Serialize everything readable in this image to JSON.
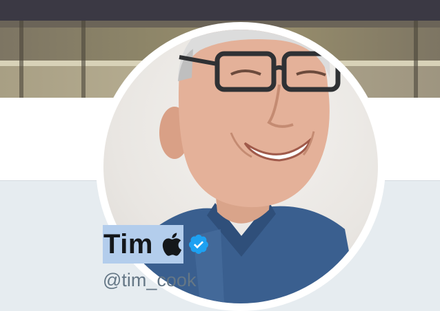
{
  "profile": {
    "display_name": "Tim",
    "emoji": "apple-logo",
    "verified": true,
    "screen_name": "@tim_cook"
  },
  "colors": {
    "background": "#e6ecf0",
    "name_text": "#14171a",
    "screen_name_text": "#657786",
    "verified_blue": "#1da1f2",
    "selection_highlight": "#b3cdec"
  }
}
